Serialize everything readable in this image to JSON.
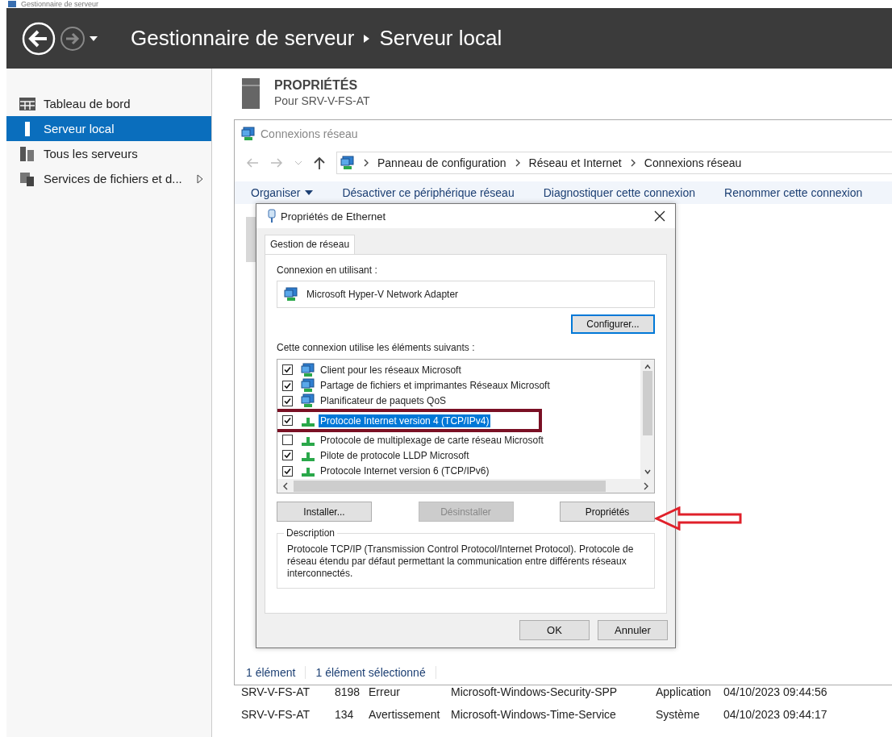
{
  "app_title": "Gestionnaire de serveur",
  "header": {
    "breadcrumb": [
      "Gestionnaire de serveur",
      "Serveur local"
    ]
  },
  "sidebar": {
    "items": [
      {
        "label": "Tableau de bord",
        "selected": false,
        "has_submenu": false
      },
      {
        "label": "Serveur local",
        "selected": true,
        "has_submenu": false
      },
      {
        "label": "Tous les serveurs",
        "selected": false,
        "has_submenu": false
      },
      {
        "label": "Services de fichiers et d...",
        "selected": false,
        "has_submenu": true
      }
    ]
  },
  "properties": {
    "title": "PROPRIÉTÉS",
    "subtitle": "Pour SRV-V-FS-AT"
  },
  "events": [
    {
      "server": "SRV-V-FS-AT",
      "id": "8198",
      "level": "Erreur",
      "source": "Microsoft-Windows-Security-SPP",
      "log": "Application",
      "date": "04/10/2023 09:44:56"
    },
    {
      "server": "SRV-V-FS-AT",
      "id": "134",
      "level": "Avertissement",
      "source": "Microsoft-Windows-Time-Service",
      "log": "Système",
      "date": "04/10/2023 09:44:17"
    }
  ],
  "explorer": {
    "title": "Connexions réseau",
    "address": [
      "Panneau de configuration",
      "Réseau et Internet",
      "Connexions réseau"
    ],
    "commands": [
      {
        "label": "Organiser",
        "has_menu": true
      },
      {
        "label": "Désactiver ce périphérique réseau",
        "has_menu": false
      },
      {
        "label": "Diagnostiquer cette connexion",
        "has_menu": false
      },
      {
        "label": "Renommer cette connexion",
        "has_menu": false
      }
    ],
    "status": [
      "1 élément",
      "1 élément sélectionné"
    ]
  },
  "dialog": {
    "title": "Propriétés de Ethernet",
    "tabs": [
      {
        "label": "Gestion de réseau",
        "selected": true
      }
    ],
    "connect_label": "Connexion en utilisant :",
    "adapter": "Microsoft Hyper-V Network Adapter",
    "configure": "Configurer...",
    "items_label": "Cette connexion utilise les éléments suivants :",
    "items": [
      {
        "label": "Client pour les réseaux Microsoft",
        "kind": "service",
        "checked": true,
        "selected": false,
        "highlighted": false
      },
      {
        "label": "Partage de fichiers et imprimantes Réseaux Microsoft",
        "kind": "service",
        "checked": true,
        "selected": false,
        "highlighted": false
      },
      {
        "label": "Planificateur de paquets QoS",
        "kind": "service",
        "checked": true,
        "selected": false,
        "highlighted": false
      },
      {
        "label": "Protocole Internet version 4 (TCP/IPv4)",
        "kind": "protocol",
        "checked": true,
        "selected": true,
        "highlighted": true
      },
      {
        "label": "Protocole de multiplexage de carte réseau Microsoft",
        "kind": "protocol",
        "checked": false,
        "selected": false,
        "highlighted": false
      },
      {
        "label": "Pilote de protocole LLDP Microsoft",
        "kind": "protocol",
        "checked": true,
        "selected": false,
        "highlighted": false
      },
      {
        "label": "Protocole Internet version 6 (TCP/IPv6)",
        "kind": "protocol",
        "checked": true,
        "selected": false,
        "highlighted": false
      }
    ],
    "buttons": [
      {
        "label": "Installer...",
        "disabled": false
      },
      {
        "label": "Désinstaller",
        "disabled": true
      },
      {
        "label": "Propriétés",
        "disabled": false
      }
    ],
    "description_title": "Description",
    "description": "Protocole TCP/IP (Transmission Control Protocol/Internet Protocol). Protocole de réseau étendu par défaut permettant la communication entre différents réseaux interconnectés.",
    "footer_buttons": [
      "OK",
      "Annuler"
    ]
  }
}
